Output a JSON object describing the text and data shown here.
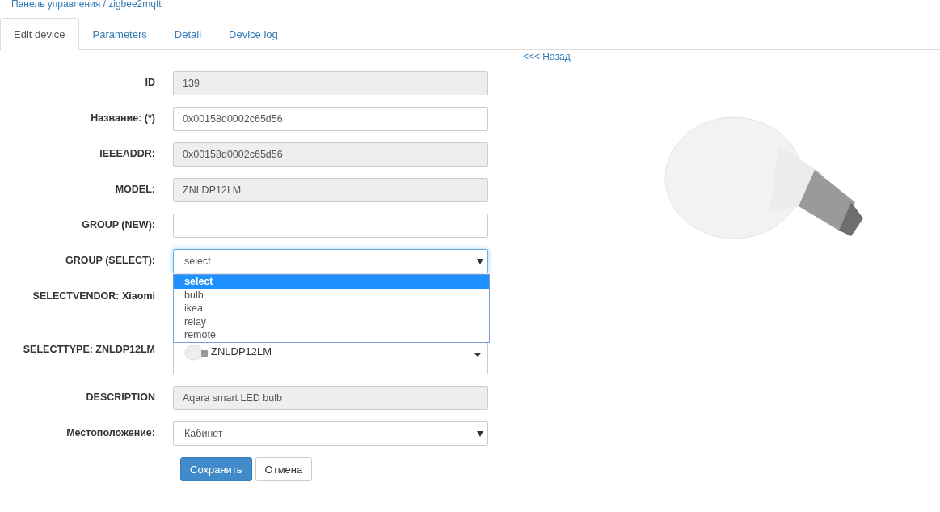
{
  "breadcrumb": "Панель управления / zigbee2mqtt",
  "tabs": [
    {
      "label": "Edit device",
      "selected": true
    },
    {
      "label": "Parameters",
      "selected": false
    },
    {
      "label": "Detail",
      "selected": false
    },
    {
      "label": "Device log",
      "selected": false
    }
  ],
  "back_link": "<<< Назад",
  "fields": [
    {
      "kind": "readonly",
      "label": "ID",
      "value": "139"
    },
    {
      "kind": "text",
      "label": "Название: (*)",
      "value": "0x00158d0002c65d56"
    },
    {
      "kind": "readonly",
      "label": "IEEEADDR:",
      "value": "0x00158d0002c65d56"
    },
    {
      "kind": "readonly",
      "label": "MODEL:",
      "value": "ZNLDP12LM"
    },
    {
      "kind": "text",
      "label": "GROUP (NEW):"
    },
    {
      "kind": "select",
      "label": "GROUP (SELECT):",
      "value": "select",
      "focused": true,
      "expanded": true,
      "options": [
        {
          "label": "select",
          "selected": true
        },
        {
          "label": "bulb",
          "selected": false
        },
        {
          "label": "ikea",
          "selected": false
        },
        {
          "label": "relay",
          "selected": false
        },
        {
          "label": "remote",
          "selected": false
        }
      ]
    },
    {
      "kind": "label",
      "label": "SELECTVENDOR: Xiaomi"
    },
    {
      "kind": "image_select",
      "label": "SELECTTYPE: ZNLDP12LM",
      "value": "ZNLDP12LM"
    },
    {
      "kind": "readonly",
      "label": "DESCRIPTION",
      "value": "Aqara smart LED bulb"
    },
    {
      "kind": "select",
      "label": "Местоположение:",
      "value": "Кабинет",
      "focused": false
    }
  ],
  "buttons": [
    {
      "label": "Сохранить",
      "kind": "primary"
    },
    {
      "label": "Отмена",
      "kind": "default"
    }
  ]
}
